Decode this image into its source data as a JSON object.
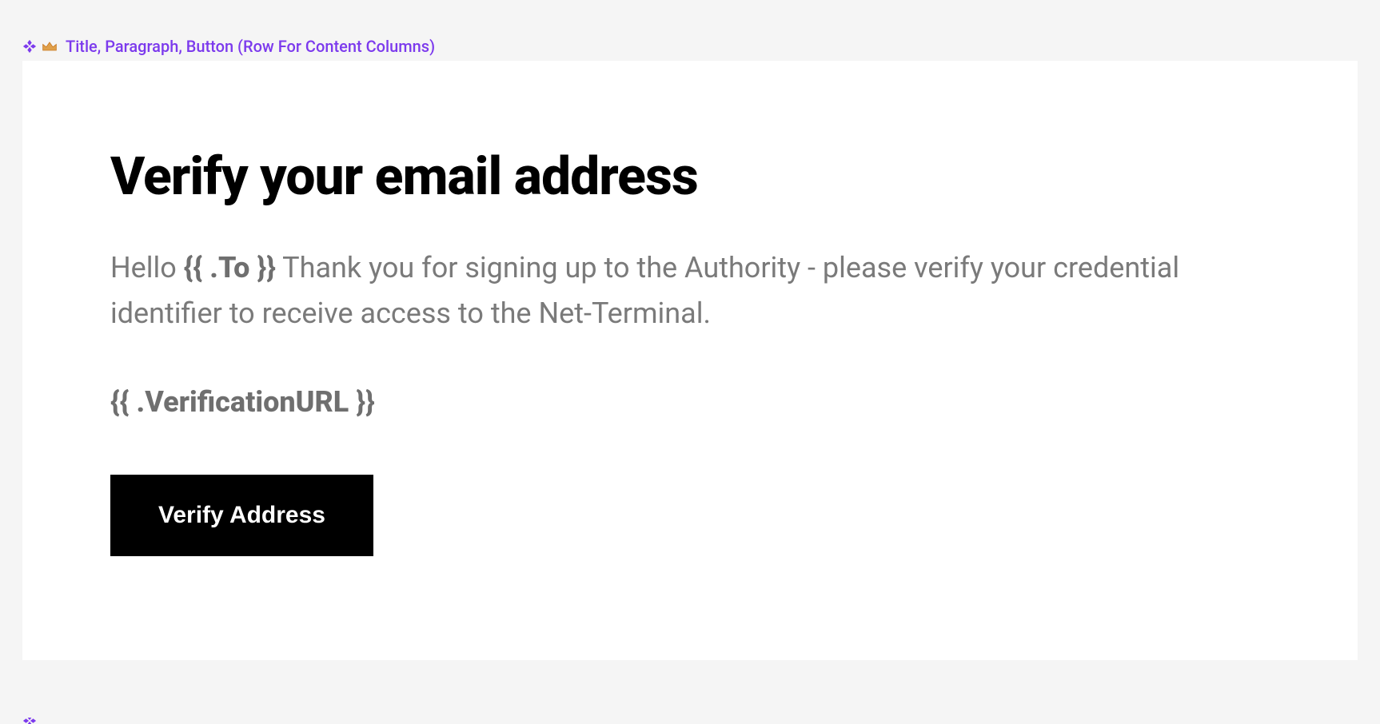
{
  "block": {
    "label": "Title, Paragraph, Button (Row For Content Columns)"
  },
  "content": {
    "title": "Verify your email address",
    "paragraph_pre": "Hello ",
    "paragraph_token": "{{ .To }}",
    "paragraph_post": " Thank you for signing up to the Authority - please verify your credential identifier to receive access to the Net-Terminal.",
    "verification_url": "{{ .VerificationURL }}",
    "button_label": "Verify Address"
  }
}
